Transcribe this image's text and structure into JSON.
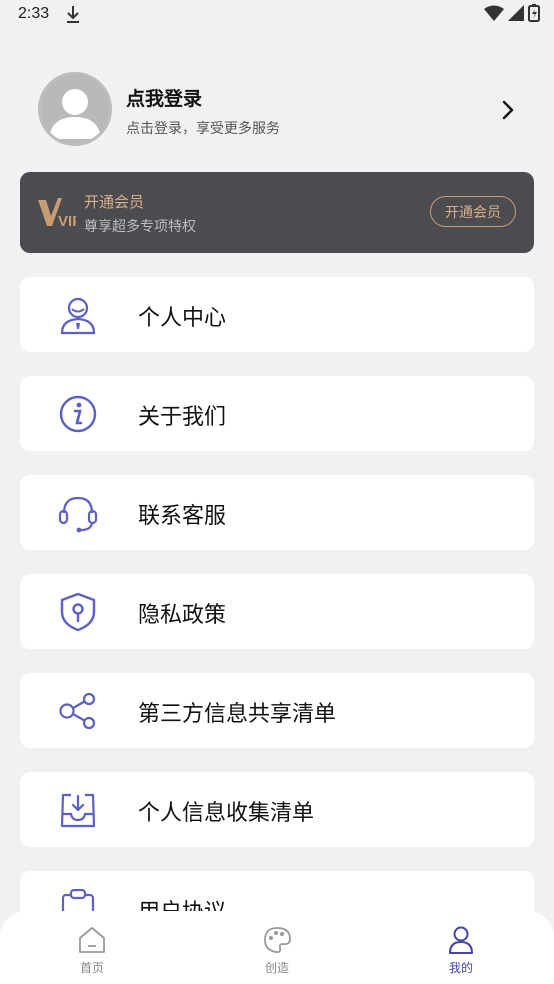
{
  "status_bar": {
    "time": "2:33"
  },
  "profile": {
    "title": "点我登录",
    "subtitle": "点击登录，享受更多服务"
  },
  "vip": {
    "logo_text": "VIP",
    "title": "开通会员",
    "subtitle": "尊享超多专项特权",
    "button": "开通会员",
    "colors": {
      "card": "#4c4b50",
      "gold": "#d8b08a"
    }
  },
  "menu": {
    "accent_color": "#5a60c8",
    "items": [
      {
        "label": "个人中心",
        "icon": "user-icon"
      },
      {
        "label": "关于我们",
        "icon": "info-icon"
      },
      {
        "label": "联系客服",
        "icon": "headset-icon"
      },
      {
        "label": "隐私政策",
        "icon": "shield-icon"
      },
      {
        "label": "第三方信息共享清单",
        "icon": "share-icon"
      },
      {
        "label": "个人信息收集清单",
        "icon": "inbox-icon"
      },
      {
        "label": "用户协议",
        "icon": "clipboard-icon"
      }
    ]
  },
  "bottom_nav": {
    "tabs": [
      {
        "label": "首页",
        "icon": "home-icon",
        "active": false
      },
      {
        "label": "创造",
        "icon": "palette-icon",
        "active": false
      },
      {
        "label": "我的",
        "icon": "person-icon",
        "active": true
      }
    ]
  }
}
